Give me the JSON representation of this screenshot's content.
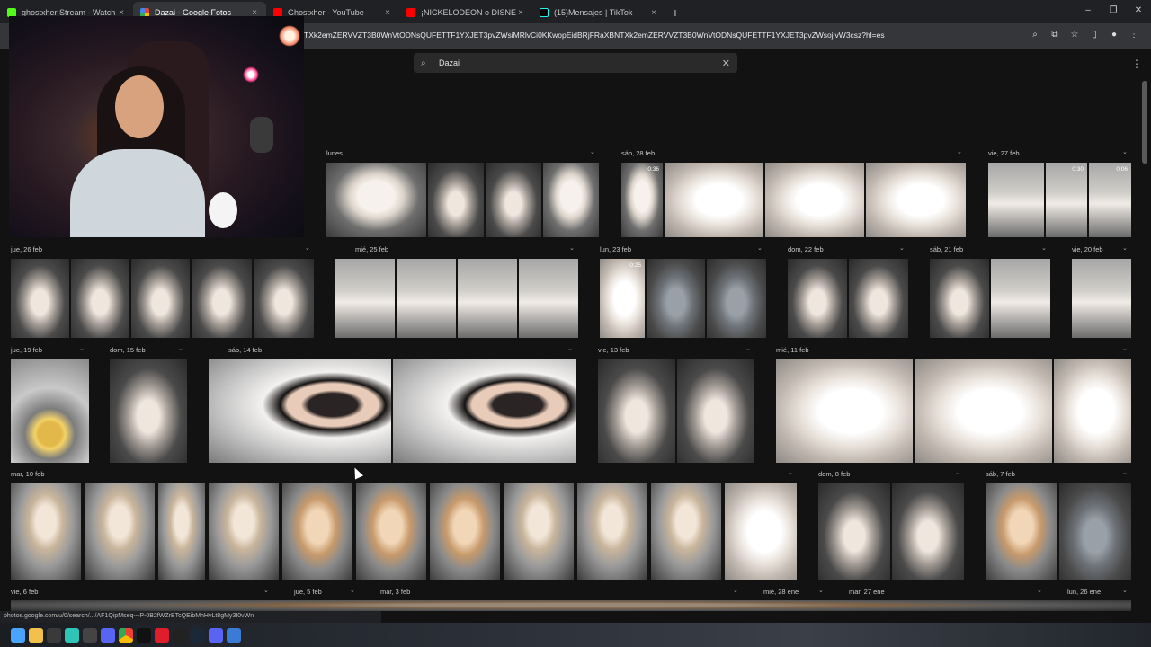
{
  "browser": {
    "tabs": [
      {
        "label": "ghostxher Stream - Watch Live",
        "favicon_color": "#53fc18",
        "active": false
      },
      {
        "label": "Dazai - Google Fotos",
        "favicon_color": "#fbbc04",
        "active": true
      },
      {
        "label": "Ghostxher - YouTube",
        "favicon_color": "#ff0000",
        "active": false
      },
      {
        "label": "¡NICKELODEON o DISNEY CHA",
        "favicon_color": "#ff0000",
        "active": false
      },
      {
        "label": "(15)Mensajes | TikTok",
        "favicon_color": "#000000",
        "active": false
      }
    ],
    "close_glyph": "×",
    "newtab_glyph": "+",
    "url": "TXk2emZERVVZT3B0WnVtODNsQUFETTF1YXJET3pvZWsiMRlvCi0KKwopEidBRjFRaXBNTXk2emZERVVZT3B0WnVtODNsQUFETTF1YXJET3pvZWsojlvW3csz?hl=es",
    "window_controls": [
      "–",
      "❐",
      "✕"
    ]
  },
  "search": {
    "value": "Dazai",
    "icon": "search-icon",
    "clear": "✕"
  },
  "more_glyph": "⋮",
  "dates": [
    {
      "label": "lunes",
      "id": "lunes"
    },
    {
      "label": "sáb, 28 feb",
      "id": "sab28"
    },
    {
      "label": "vie, 27 feb",
      "id": "vie27"
    },
    {
      "label": "jue, 26 feb",
      "id": "jue26"
    },
    {
      "label": "mié, 25 feb",
      "id": "mie25"
    },
    {
      "label": "lun, 23 feb",
      "id": "lun23"
    },
    {
      "label": "dom, 22 feb",
      "id": "dom22"
    },
    {
      "label": "sáb, 21 feb",
      "id": "sab21"
    },
    {
      "label": "vie, 20 feb",
      "id": "vie20"
    },
    {
      "label": "jue, 19 feb",
      "id": "jue19"
    },
    {
      "label": "dom, 15 feb",
      "id": "dom15"
    },
    {
      "label": "sáb, 14 feb",
      "id": "sab14"
    },
    {
      "label": "vie, 13 feb",
      "id": "vie13"
    },
    {
      "label": "mié, 11 feb",
      "id": "mie11"
    },
    {
      "label": "mar, 10 feb",
      "id": "mar10"
    },
    {
      "label": "dom, 8 feb",
      "id": "dom8"
    },
    {
      "label": "sáb, 7 feb",
      "id": "sab7"
    },
    {
      "label": "vie, 6 feb",
      "id": "vie6"
    },
    {
      "label": "jue, 5 feb",
      "id": "jue5"
    },
    {
      "label": "mar, 3 feb",
      "id": "mar3"
    },
    {
      "label": "mié, 28 ene",
      "id": "mie28"
    },
    {
      "label": "mar, 27 ene",
      "id": "mar27"
    },
    {
      "label": "lun, 26 ene",
      "id": "lun26"
    }
  ],
  "video_durations": [
    "0:36",
    "0:30",
    "0:06",
    "0:25"
  ],
  "status_url": "photos.google.com/u/0/search/.../AF1QipMseq---P-0B2fWZrBTcQEibMhHvLt8gMy3I0vWn",
  "chevron": "⌄"
}
